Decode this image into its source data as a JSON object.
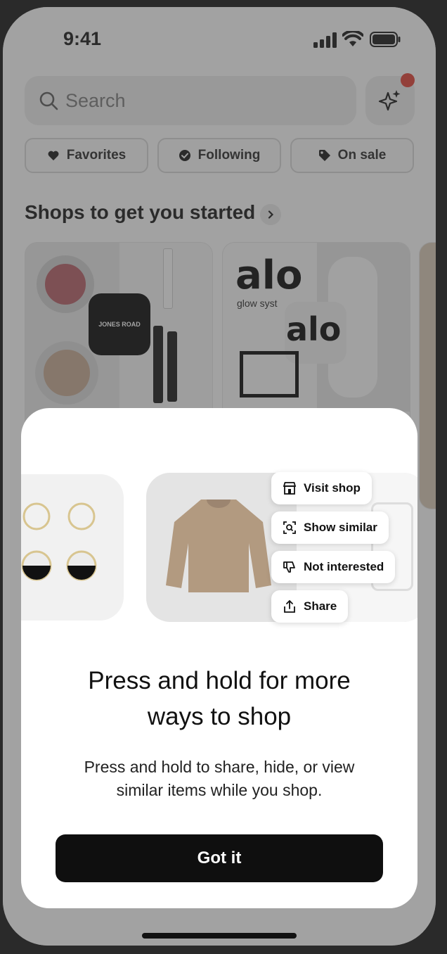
{
  "status": {
    "time": "9:41"
  },
  "search": {
    "placeholder": "Search"
  },
  "chips": [
    {
      "label": "Favorites",
      "icon": "heart-icon"
    },
    {
      "label": "Following",
      "icon": "check-badge-icon"
    },
    {
      "label": "On sale",
      "icon": "tag-icon"
    }
  ],
  "section": {
    "title": "Shops to get you started"
  },
  "shops": [
    {
      "brand": "JONES ROAD"
    },
    {
      "brand": "alo",
      "tagline": "glow syst"
    }
  ],
  "sheet": {
    "menu": [
      {
        "label": "Visit shop",
        "icon": "store-icon"
      },
      {
        "label": "Show similar",
        "icon": "scan-search-icon"
      },
      {
        "label": "Not interested",
        "icon": "thumbs-down-icon"
      },
      {
        "label": "Share",
        "icon": "share-icon"
      }
    ],
    "title": "Press and hold for more ways to shop",
    "description": "Press and hold to share, hide, or view similar items while you shop.",
    "button": "Got it"
  },
  "colors": {
    "notification_dot": "#e03a2f",
    "button_bg": "#0f0f0f"
  }
}
